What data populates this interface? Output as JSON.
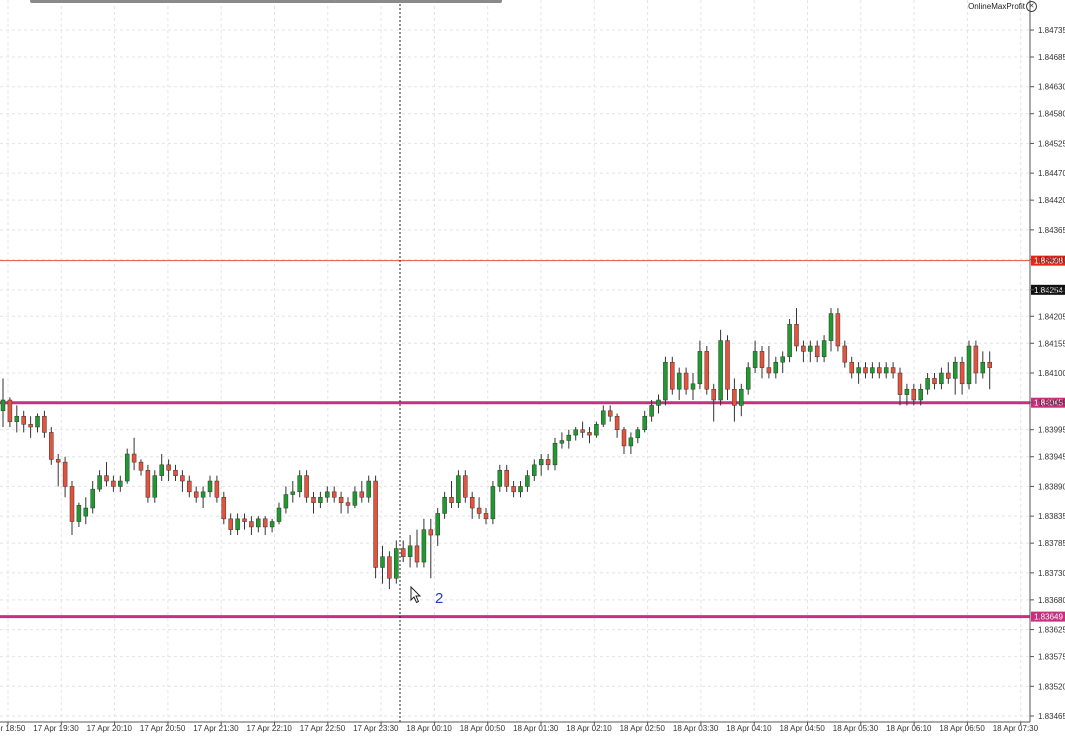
{
  "header": {
    "brand": "OnlineMaxProfit",
    "close_glyph": "✕"
  },
  "annotation": {
    "text": "2"
  },
  "chart_data": {
    "type": "candlestick",
    "title": "",
    "y_ticks": [
      "1.84735",
      "1.84685",
      "1.84630",
      "1.84580",
      "1.84525",
      "1.84470",
      "1.84420",
      "1.84365",
      "1.84310",
      "1.84254",
      "1.84205",
      "1.84155",
      "1.84100",
      "1.84045",
      "1.83995",
      "1.83945",
      "1.83890",
      "1.83835",
      "1.83785",
      "1.83730",
      "1.83680",
      "1.83625",
      "1.83575",
      "1.83520",
      "1.83465"
    ],
    "x_ticks": [
      "17 Apr 18:50",
      "17 Apr 19:30",
      "17 Apr 20:10",
      "17 Apr 20:50",
      "17 Apr 21:30",
      "17 Apr 22:10",
      "17 Apr 22:50",
      "17 Apr 23:30",
      "18 Apr 00:10",
      "18 Apr 00:50",
      "18 Apr 01:30",
      "18 Apr 02:10",
      "18 Apr 02:50",
      "18 Apr 03:30",
      "18 Apr 04:10",
      "18 Apr 04:50",
      "18 Apr 05:30",
      "18 Apr 06:10",
      "18 Apr 06:50",
      "18 Apr 07:30"
    ],
    "ylim": [
      1.83465,
      1.84765
    ],
    "levels": [
      {
        "label": "1.84308",
        "value": 1.84308,
        "color": "#e8543a",
        "badge_bg": "#e8251a",
        "width": 1
      },
      {
        "label": "1.84254",
        "value": 1.84254,
        "color": null,
        "badge_bg": "#111111",
        "width": 0
      },
      {
        "label": "1.84045",
        "value": 1.84045,
        "color": "#c8307e",
        "badge_bg": "#c8307e",
        "width": 3
      },
      {
        "label": "1.83649",
        "value": 1.83649,
        "color": "#c8307e",
        "badge_bg": "#c8307e",
        "width": 3
      }
    ],
    "colors": {
      "bull": "#1f9a2e",
      "bear": "#e5533c",
      "grid": "#e4e4e4",
      "axis": "#555555"
    },
    "candles": [
      [
        1.8403,
        1.8409,
        1.84,
        1.8405
      ],
      [
        1.8405,
        1.84055,
        1.84,
        1.8401
      ],
      [
        1.8401,
        1.8404,
        1.8399,
        1.8402
      ],
      [
        1.8402,
        1.8403,
        1.8399,
        1.84005
      ],
      [
        1.84005,
        1.8402,
        1.8398,
        1.84
      ],
      [
        1.84,
        1.84025,
        1.8399,
        1.8402
      ],
      [
        1.8402,
        1.8403,
        1.8398,
        1.8399
      ],
      [
        1.8399,
        1.84,
        1.8393,
        1.8394
      ],
      [
        1.8394,
        1.8395,
        1.8389,
        1.83935
      ],
      [
        1.83935,
        1.83945,
        1.8387,
        1.8389
      ],
      [
        1.8389,
        1.839,
        1.838,
        1.83825
      ],
      [
        1.83825,
        1.8386,
        1.83815,
        1.83855
      ],
      [
        1.83835,
        1.8387,
        1.8382,
        1.8385
      ],
      [
        1.8385,
        1.839,
        1.8384,
        1.83885
      ],
      [
        1.83885,
        1.8392,
        1.8388,
        1.8391
      ],
      [
        1.8391,
        1.83935,
        1.8389,
        1.839
      ],
      [
        1.839,
        1.8391,
        1.8388,
        1.8389
      ],
      [
        1.8389,
        1.8391,
        1.8388,
        1.839
      ],
      [
        1.839,
        1.8396,
        1.83895,
        1.8395
      ],
      [
        1.8395,
        1.8398,
        1.8392,
        1.83935
      ],
      [
        1.83935,
        1.8394,
        1.8391,
        1.8392
      ],
      [
        1.8392,
        1.8393,
        1.8386,
        1.8387
      ],
      [
        1.8387,
        1.8392,
        1.8386,
        1.8391
      ],
      [
        1.8391,
        1.8395,
        1.839,
        1.8393
      ],
      [
        1.8393,
        1.8394,
        1.839,
        1.8392
      ],
      [
        1.8392,
        1.8393,
        1.839,
        1.8391
      ],
      [
        1.8391,
        1.8392,
        1.8388,
        1.839
      ],
      [
        1.839,
        1.8391,
        1.8387,
        1.8388
      ],
      [
        1.8388,
        1.8389,
        1.8386,
        1.8387
      ],
      [
        1.8387,
        1.8389,
        1.8385,
        1.8388
      ],
      [
        1.8388,
        1.8391,
        1.8387,
        1.839
      ],
      [
        1.839,
        1.8391,
        1.8386,
        1.8387
      ],
      [
        1.8387,
        1.8388,
        1.8382,
        1.8383
      ],
      [
        1.8383,
        1.8384,
        1.838,
        1.8381
      ],
      [
        1.8381,
        1.8384,
        1.838,
        1.8383
      ],
      [
        1.8383,
        1.8384,
        1.8381,
        1.83825
      ],
      [
        1.83825,
        1.83835,
        1.838,
        1.83815
      ],
      [
        1.83815,
        1.83835,
        1.83805,
        1.8383
      ],
      [
        1.8383,
        1.83835,
        1.838,
        1.83815
      ],
      [
        1.83815,
        1.8383,
        1.83805,
        1.83825
      ],
      [
        1.83825,
        1.8386,
        1.8382,
        1.8385
      ],
      [
        1.8385,
        1.8389,
        1.8384,
        1.83875
      ],
      [
        1.83875,
        1.839,
        1.8386,
        1.8388
      ],
      [
        1.8388,
        1.8392,
        1.8387,
        1.8391
      ],
      [
        1.8391,
        1.8392,
        1.8386,
        1.8387
      ],
      [
        1.8387,
        1.8388,
        1.8384,
        1.8386
      ],
      [
        1.8386,
        1.8388,
        1.8385,
        1.8387
      ],
      [
        1.8387,
        1.8389,
        1.8386,
        1.8388
      ],
      [
        1.8388,
        1.8389,
        1.8386,
        1.8387
      ],
      [
        1.8387,
        1.8388,
        1.8384,
        1.8386
      ],
      [
        1.8386,
        1.8387,
        1.8384,
        1.83855
      ],
      [
        1.83855,
        1.8389,
        1.8385,
        1.8388
      ],
      [
        1.8388,
        1.839,
        1.8386,
        1.8387
      ],
      [
        1.8387,
        1.8391,
        1.8386,
        1.839
      ],
      [
        1.839,
        1.8391,
        1.8372,
        1.8374
      ],
      [
        1.8374,
        1.8378,
        1.8371,
        1.8376
      ],
      [
        1.8376,
        1.8377,
        1.837,
        1.8372
      ],
      [
        1.8372,
        1.8379,
        1.8371,
        1.83775
      ],
      [
        1.83775,
        1.8379,
        1.8375,
        1.8376
      ],
      [
        1.8376,
        1.838,
        1.8374,
        1.8378
      ],
      [
        1.8378,
        1.8381,
        1.8374,
        1.8375
      ],
      [
        1.8375,
        1.8383,
        1.8374,
        1.8381
      ],
      [
        1.8381,
        1.8383,
        1.8372,
        1.838
      ],
      [
        1.838,
        1.8385,
        1.8378,
        1.8384
      ],
      [
        1.8384,
        1.8388,
        1.8383,
        1.8387
      ],
      [
        1.8387,
        1.839,
        1.8385,
        1.8386
      ],
      [
        1.8386,
        1.8392,
        1.8385,
        1.8391
      ],
      [
        1.8391,
        1.8392,
        1.8386,
        1.8387
      ],
      [
        1.8387,
        1.8388,
        1.8383,
        1.8385
      ],
      [
        1.8385,
        1.8387,
        1.8383,
        1.8384
      ],
      [
        1.8384,
        1.8385,
        1.8382,
        1.8383
      ],
      [
        1.8383,
        1.839,
        1.8382,
        1.8389
      ],
      [
        1.8389,
        1.8393,
        1.8388,
        1.8392
      ],
      [
        1.8392,
        1.8393,
        1.8388,
        1.8389
      ],
      [
        1.8389,
        1.839,
        1.8387,
        1.8388
      ],
      [
        1.8388,
        1.839,
        1.8387,
        1.8389
      ],
      [
        1.8389,
        1.8392,
        1.8388,
        1.8391
      ],
      [
        1.8391,
        1.8394,
        1.839,
        1.8393
      ],
      [
        1.8393,
        1.8395,
        1.8391,
        1.8394
      ],
      [
        1.8394,
        1.8395,
        1.8392,
        1.8393
      ],
      [
        1.8393,
        1.8398,
        1.8392,
        1.8397
      ],
      [
        1.8397,
        1.8399,
        1.8396,
        1.83975
      ],
      [
        1.83975,
        1.83995,
        1.8396,
        1.83985
      ],
      [
        1.83985,
        1.84,
        1.83975,
        1.83995
      ],
      [
        1.83995,
        1.8401,
        1.8398,
        1.8399
      ],
      [
        1.8399,
        1.84,
        1.8397,
        1.83985
      ],
      [
        1.83985,
        1.8401,
        1.8398,
        1.84005
      ],
      [
        1.84005,
        1.8404,
        1.84,
        1.8403
      ],
      [
        1.8403,
        1.8404,
        1.8401,
        1.8402
      ],
      [
        1.8402,
        1.84025,
        1.8398,
        1.83995
      ],
      [
        1.83995,
        1.84,
        1.8395,
        1.83965
      ],
      [
        1.83965,
        1.8399,
        1.8395,
        1.8398
      ],
      [
        1.8398,
        1.84,
        1.8397,
        1.83995
      ],
      [
        1.83995,
        1.8403,
        1.8399,
        1.8402
      ],
      [
        1.8402,
        1.8405,
        1.8401,
        1.8404
      ],
      [
        1.8404,
        1.8406,
        1.84025,
        1.8405
      ],
      [
        1.8405,
        1.8413,
        1.8404,
        1.8412
      ],
      [
        1.8412,
        1.8413,
        1.8406,
        1.8407
      ],
      [
        1.8407,
        1.8411,
        1.8405,
        1.841
      ],
      [
        1.841,
        1.8411,
        1.8406,
        1.8407
      ],
      [
        1.8407,
        1.841,
        1.8405,
        1.8408
      ],
      [
        1.8408,
        1.8416,
        1.8407,
        1.8414
      ],
      [
        1.8414,
        1.8415,
        1.8406,
        1.8407
      ],
      [
        1.8407,
        1.8408,
        1.8401,
        1.8405
      ],
      [
        1.8405,
        1.8418,
        1.8404,
        1.8416
      ],
      [
        1.8416,
        1.8417,
        1.8405,
        1.8407
      ],
      [
        1.8407,
        1.8409,
        1.8401,
        1.8404
      ],
      [
        1.8404,
        1.8408,
        1.8402,
        1.8407
      ],
      [
        1.8407,
        1.8412,
        1.8406,
        1.8411
      ],
      [
        1.8411,
        1.8416,
        1.841,
        1.8414
      ],
      [
        1.8414,
        1.8415,
        1.8409,
        1.8411
      ],
      [
        1.8411,
        1.8415,
        1.8409,
        1.841
      ],
      [
        1.841,
        1.8413,
        1.8409,
        1.8412
      ],
      [
        1.8412,
        1.8414,
        1.841,
        1.8413
      ],
      [
        1.8413,
        1.842,
        1.8412,
        1.8419
      ],
      [
        1.8419,
        1.8422,
        1.8414,
        1.8415
      ],
      [
        1.8415,
        1.8416,
        1.8412,
        1.8414
      ],
      [
        1.8414,
        1.8416,
        1.8412,
        1.8415
      ],
      [
        1.8415,
        1.8416,
        1.8412,
        1.8413
      ],
      [
        1.8413,
        1.8417,
        1.8412,
        1.8416
      ],
      [
        1.8416,
        1.8422,
        1.8414,
        1.8421
      ],
      [
        1.8421,
        1.8422,
        1.8414,
        1.8415
      ],
      [
        1.8415,
        1.8416,
        1.8411,
        1.8412
      ],
      [
        1.8412,
        1.8413,
        1.8409,
        1.841
      ],
      [
        1.841,
        1.8412,
        1.8408,
        1.8411
      ],
      [
        1.8411,
        1.8412,
        1.8409,
        1.841
      ],
      [
        1.841,
        1.8412,
        1.8409,
        1.8411
      ],
      [
        1.8411,
        1.8412,
        1.8409,
        1.841
      ],
      [
        1.841,
        1.8412,
        1.8409,
        1.8411
      ],
      [
        1.8411,
        1.8412,
        1.8409,
        1.841
      ],
      [
        1.841,
        1.8411,
        1.8404,
        1.8406
      ],
      [
        1.8406,
        1.8408,
        1.8404,
        1.8407
      ],
      [
        1.8407,
        1.8408,
        1.8404,
        1.8405
      ],
      [
        1.8405,
        1.8408,
        1.8404,
        1.8407
      ],
      [
        1.8407,
        1.841,
        1.8406,
        1.8409
      ],
      [
        1.8409,
        1.841,
        1.8407,
        1.8408
      ],
      [
        1.8408,
        1.8411,
        1.8407,
        1.841
      ],
      [
        1.841,
        1.8412,
        1.8408,
        1.8409
      ],
      [
        1.8409,
        1.8413,
        1.8406,
        1.8412
      ],
      [
        1.8412,
        1.8413,
        1.8406,
        1.8408
      ],
      [
        1.8408,
        1.8416,
        1.8407,
        1.8415
      ],
      [
        1.8415,
        1.8416,
        1.8408,
        1.841
      ],
      [
        1.841,
        1.8414,
        1.8409,
        1.8412
      ],
      [
        1.8412,
        1.8414,
        1.8407,
        1.8411
      ]
    ]
  }
}
